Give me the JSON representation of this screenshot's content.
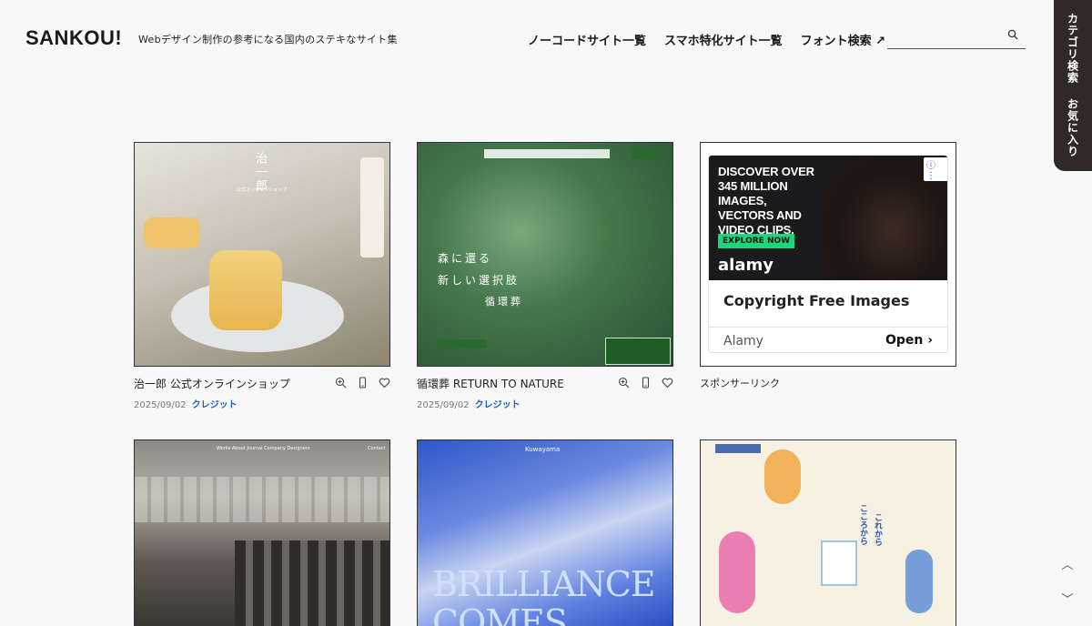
{
  "header": {
    "logo": "SANKOU!",
    "tagline": "Webデザイン制作の参考になる国内のステキなサイト集",
    "nav": [
      {
        "label": "ノーコードサイト一覧"
      },
      {
        "label": "スマホ特化サイト一覧"
      },
      {
        "label": "フォント検索 ↗"
      }
    ],
    "search": {
      "value": "",
      "placeholder": "",
      "icon": "search-icon"
    }
  },
  "side_tab": {
    "items": [
      {
        "label": "カテゴリ検索"
      },
      {
        "label": "お気に入り"
      }
    ],
    "bg_color": "#2f2a28"
  },
  "cards": [
    {
      "title": "治一郎 公式オンラインショップ",
      "date": "2025/09/02",
      "credit": "クレジット",
      "actions": [
        "zoom-icon",
        "mobile-icon",
        "heart-icon"
      ]
    },
    {
      "title": "循環葬 RETURN TO NATURE",
      "date": "2025/09/02",
      "credit": "クレジット",
      "actions": [
        "zoom-icon",
        "mobile-icon",
        "heart-icon"
      ]
    },
    {
      "title": "",
      "date": "",
      "credit": ""
    },
    {
      "title": "",
      "date": "",
      "credit": ""
    },
    {
      "title": "",
      "date": "",
      "credit": ""
    }
  ],
  "thumb_text": {
    "t1_logo": "治一郎",
    "t1_sub": "公式オンラインショップ",
    "t2_line1": "森に還る",
    "t2_line2": "新しい選択肢",
    "t2_line3": "循環葬",
    "t4_nav": "Works  About  Journal  Company  Designers",
    "t4_contact": "Contact",
    "t5_brand": "Kuwayama",
    "t5_big1": "BRILLIANCE",
    "t5_big2": "COMES",
    "t6_vert1": "これから",
    "t6_vert2": "こころから"
  },
  "ad": {
    "headline": "DISCOVER OVER 345 MILLION IMAGES, VECTORS AND VIDEO CLIPS.",
    "explore": "EXPLORE NOW",
    "brand": "alamy",
    "copy": "Copyright Free Images",
    "advertiser": "Alamy",
    "cta": "Open ›"
  },
  "sponsor_label": "スポンサーリンク",
  "scroll": {
    "up": "︿",
    "down": "﹀"
  },
  "colors": {
    "accent_link": "#1a5dc0",
    "green_cta": "#17d87a"
  }
}
